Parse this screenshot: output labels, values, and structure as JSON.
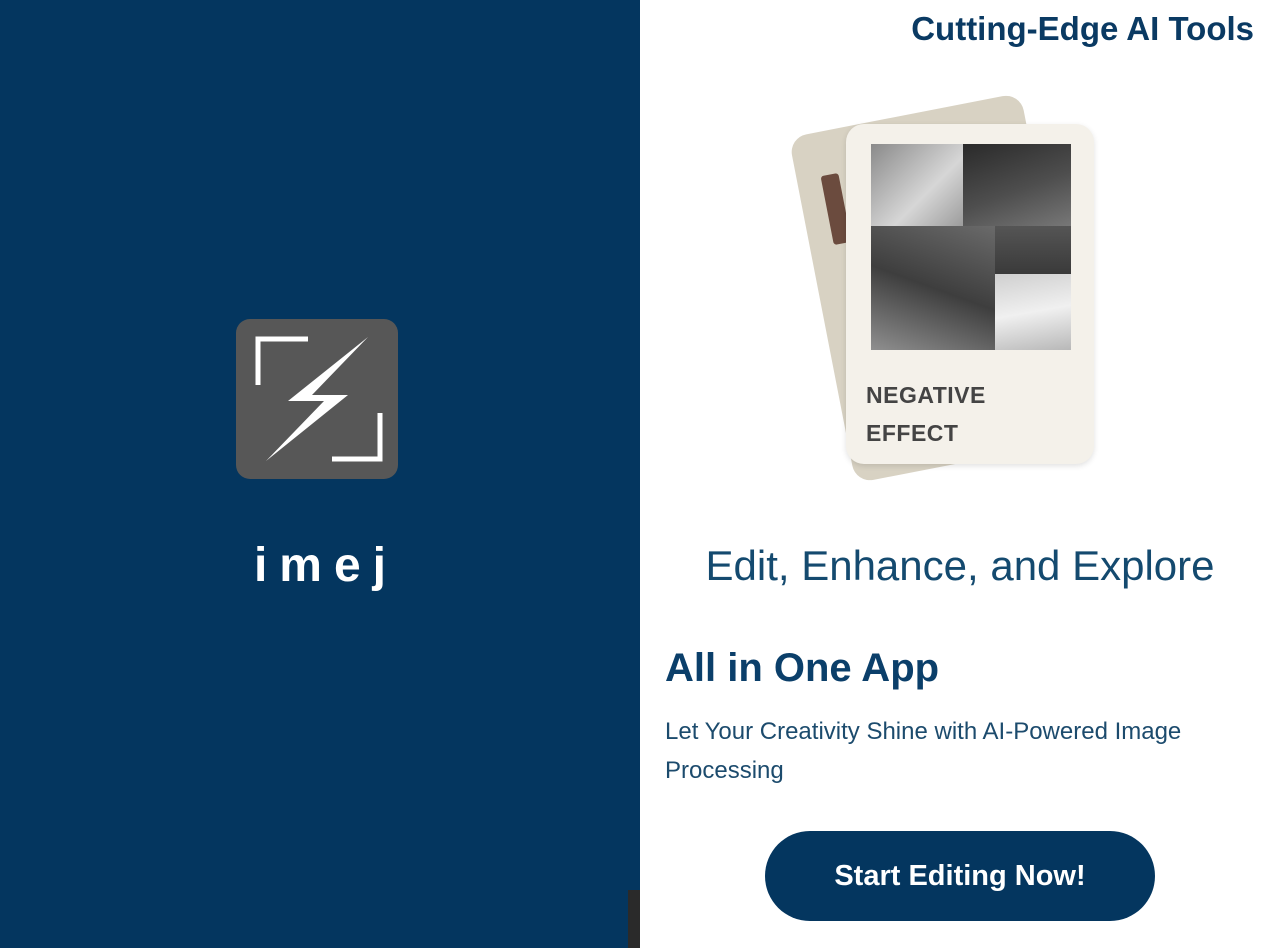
{
  "splash": {
    "app_name": "imej",
    "logo_icon": "bolt-in-frame-icon",
    "background_color": "#04365f"
  },
  "onboarding": {
    "top_title": "Cutting-Edge AI Tools",
    "card": {
      "label_line1": "NEGATIVE",
      "label_line2": "EFFECT"
    },
    "headline": "Edit, Enhance, and Explore",
    "subheadline": "All in One App",
    "description": "Let Your Creativity Shine with AI-Powered Image Processing",
    "cta_label": "Start Editing Now!",
    "accent_color": "#04365f"
  }
}
